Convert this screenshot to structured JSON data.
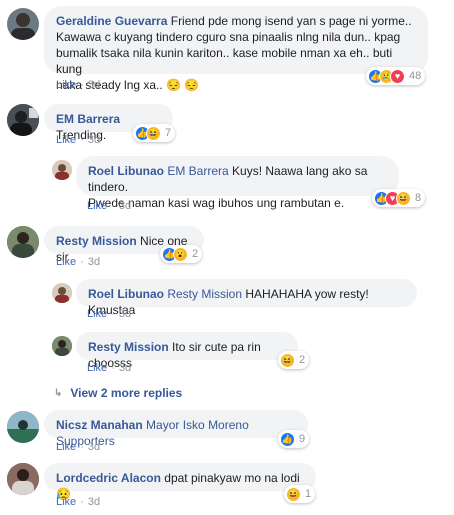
{
  "comments": [
    {
      "name": "Geraldine Guevarra",
      "lines": [
        "Friend pde mong isend yan s page ni yorme..",
        "Kawawa c kuyang tindero cguro sna pinaalis nlng nila dun.. kpag",
        "bumalik tsaka nila kunin kariton.. kase mobile nman xa eh.. buti kung",
        "naka steady lng xa.."
      ],
      "emoji": "😔 😔",
      "like": "Like",
      "time": "3d",
      "reactions": [
        "like",
        "sad",
        "love"
      ],
      "count": "48"
    },
    {
      "name": "EM Barrera",
      "text": "Trending.",
      "like": "Like",
      "time": "3d",
      "reactions": [
        "like",
        "haha"
      ],
      "count": "7"
    },
    {
      "name": "Roel Libunao",
      "mention": "EM Barrera",
      "lines": [
        "Kuys! Naawa lang ako sa tindero.",
        "Pwede naman kasi wag ibuhos ung rambutan e."
      ],
      "like": "Like",
      "time": "3d",
      "reactions": [
        "like",
        "love",
        "haha"
      ],
      "count": "8"
    },
    {
      "name": "Resty Mission",
      "text": "Nice one sir",
      "like": "Like",
      "time": "3d",
      "reactions": [
        "like",
        "wow"
      ],
      "count": "2"
    },
    {
      "name": "Roel Libunao",
      "mention": "Resty Mission",
      "text": "HAHAHAHA yow resty! Kmustaa",
      "like": "Like",
      "time": "3d"
    },
    {
      "name": "Resty Mission",
      "text": "Ito sir cute pa rin choosss",
      "like": "Like",
      "time": "3d",
      "reactions": [
        "haha"
      ],
      "count": "2"
    },
    {
      "name": "Nicsz Manahan",
      "mention": "Mayor Isko Moreno Supporters",
      "like": "Like",
      "time": "3d",
      "reactions": [
        "like"
      ],
      "count": "9"
    },
    {
      "name": "Lordcedric Alacon",
      "text": "dpat pinakyaw mo na lodi",
      "emoji": "😥",
      "like": "Like",
      "time": "3d",
      "reactions": [
        "haha"
      ],
      "count": "1"
    }
  ],
  "view_more": "View 2 more replies",
  "icons": {
    "like": "thumbs-up-icon",
    "love": "heart-icon",
    "haha": "laugh-icon",
    "sad": "sad-icon",
    "wow": "wow-icon"
  }
}
